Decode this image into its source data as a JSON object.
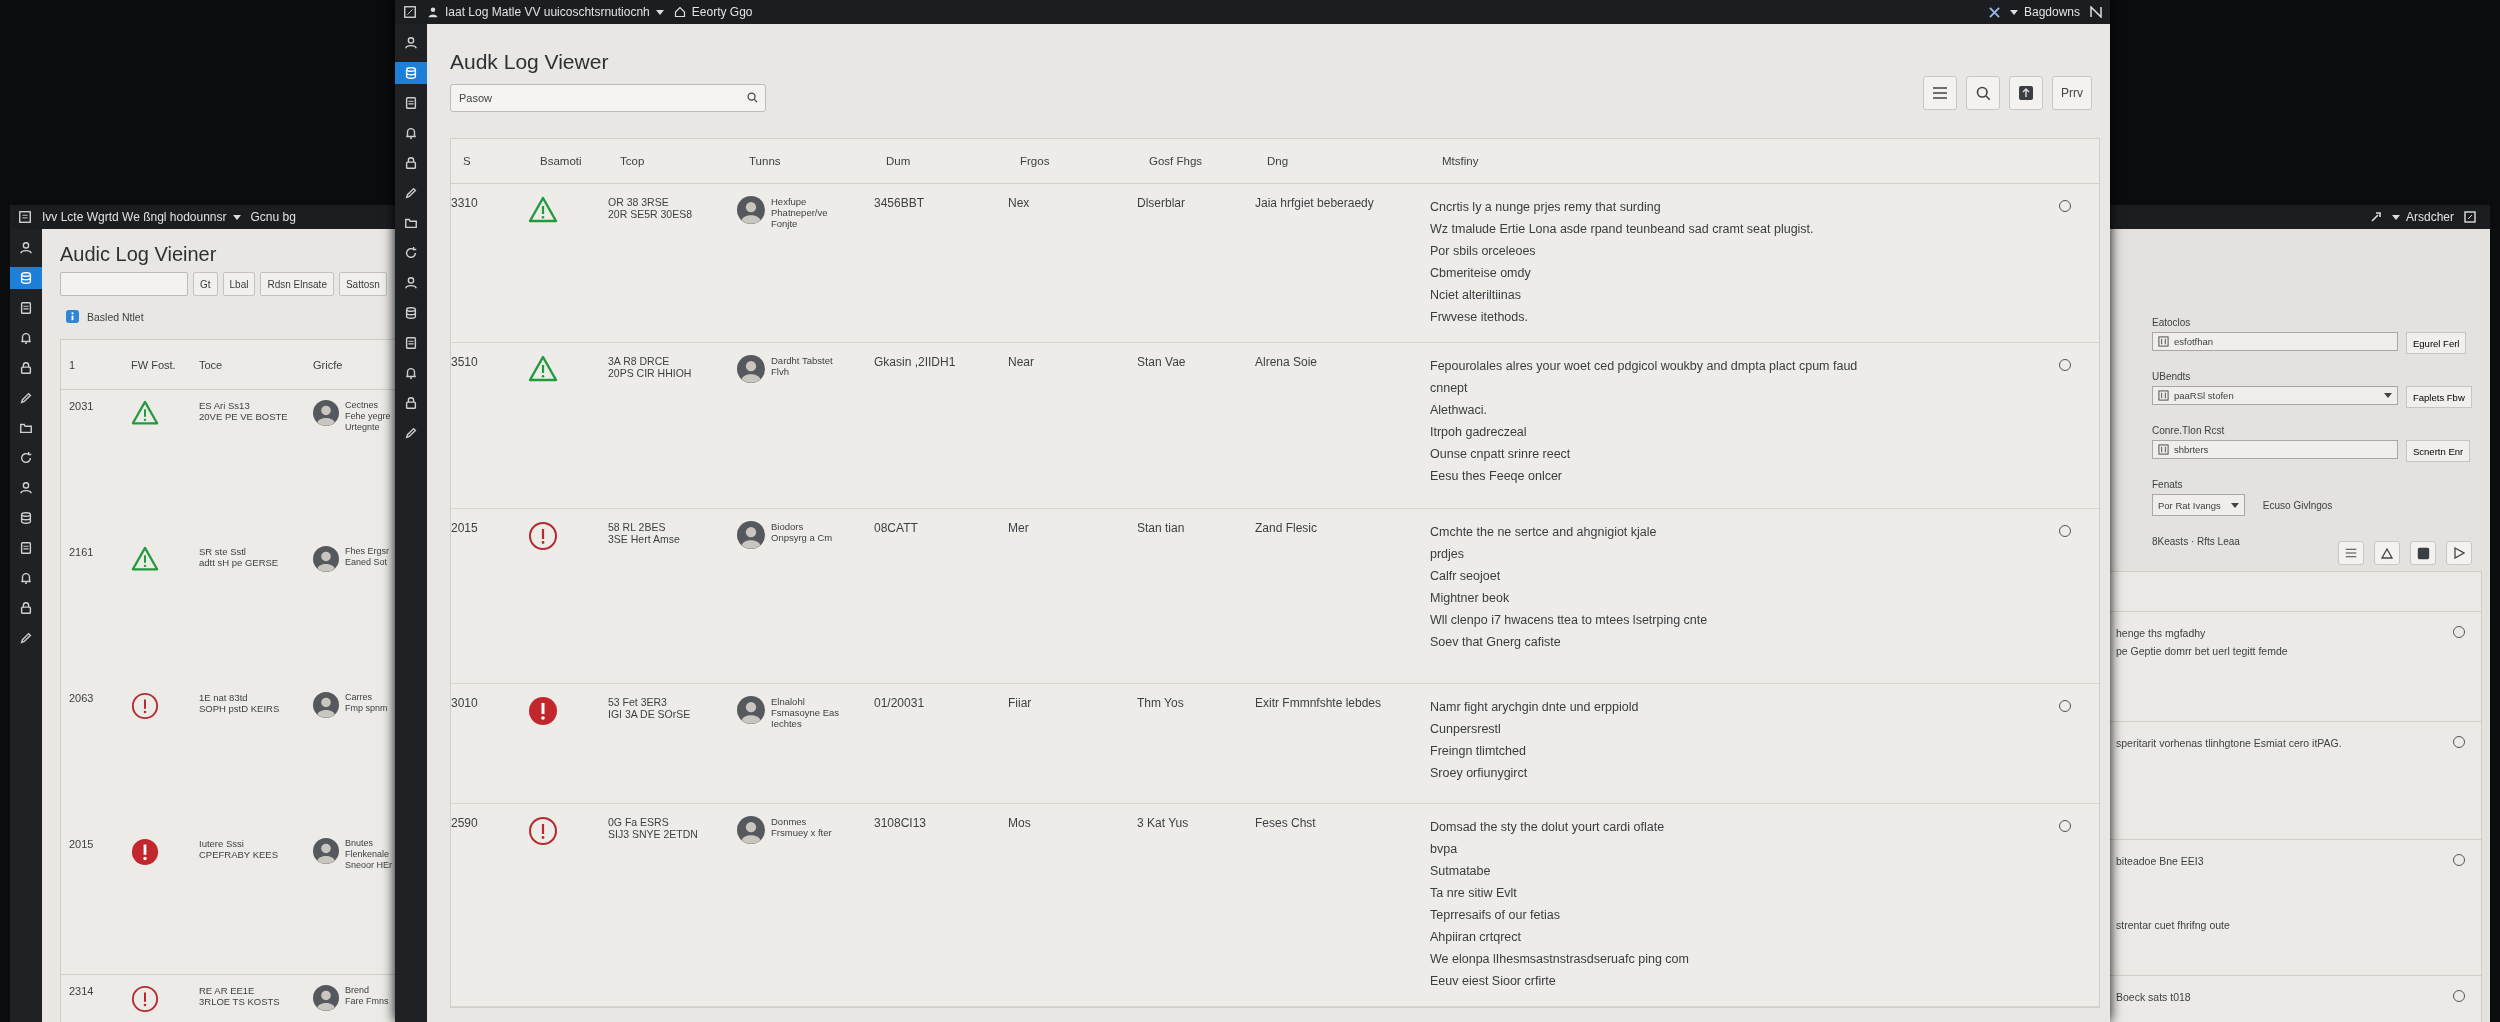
{
  "left_window": {
    "titlebar": {
      "title": "Ivv Lcte Wgrtd We ßngl hodounnsr",
      "link": "Gcnu bg"
    },
    "rail": [
      {
        "selected": false
      },
      {
        "selected": true
      },
      {
        "selected": false
      },
      {
        "selected": false
      },
      {
        "selected": false
      },
      {
        "selected": false
      },
      {
        "selected": false
      },
      {
        "selected": false
      },
      {
        "selected": false
      },
      {
        "selected": false
      },
      {
        "selected": false
      },
      {
        "selected": false
      },
      {
        "selected": false
      },
      {
        "selected": false
      }
    ],
    "heading": "Audic Log Vieiner",
    "search_button": "Gt",
    "buttons": [
      "Lbal",
      "Rdsn Elnsate",
      "Sattosn"
    ],
    "notice": "Basled Ntlet",
    "table": {
      "columns": [
        "1",
        "FW Fost.",
        "Toce",
        "Gricfe"
      ],
      "rows": [
        {
          "id": "2031",
          "kind": "warning",
          "time": [
            "ES Ari Ss13",
            "20VE PE VE BOSTE"
          ],
          "user": [
            "Cectnes",
            "Fehe yegre",
            "Urtegnte"
          ]
        },
        {
          "id": "2161",
          "kind": "warning",
          "time": [
            "SR ste Sstl",
            "adtt sH pe GERSE"
          ],
          "user": [
            "Fhes Ergsr",
            "Eaned Sot"
          ]
        },
        {
          "id": "2063",
          "kind": "error",
          "time": [
            "1E nat 83td",
            "SOPH pstD KEIRS"
          ],
          "user": [
            "Carres",
            "Fmp spnm"
          ]
        },
        {
          "id": "2015",
          "kind": "critical",
          "time": [
            "Iutere Sssi",
            "CPEFRABY KEES"
          ],
          "user": [
            "Bnutes",
            "Flenkenale",
            "Sneoor HEr"
          ]
        },
        {
          "id": "2314",
          "kind": "error",
          "time": [
            "RE AR EE1E",
            "3RLOE TS KOSTS"
          ],
          "user": [
            "Brend",
            "Fare Fmns"
          ]
        }
      ]
    }
  },
  "main_window": {
    "titlebar": {
      "app_menu": "Iaat Log Matle VV uuicoschtsrnutiocnh",
      "location": "Eeorty Ggo",
      "user": "Bagdowns"
    },
    "rail": [
      {
        "selected": false
      },
      {
        "selected": true
      },
      {
        "selected": false
      },
      {
        "selected": false
      },
      {
        "selected": false
      },
      {
        "selected": false
      },
      {
        "selected": false
      },
      {
        "selected": false
      },
      {
        "selected": false
      },
      {
        "selected": false
      },
      {
        "selected": false
      },
      {
        "selected": false
      },
      {
        "selected": false
      },
      {
        "selected": false
      }
    ],
    "heading": "Audk Log Viewer",
    "search": {
      "value": "Pasow"
    },
    "toolbar_button": "Prrv",
    "table": {
      "columns": [
        "S",
        "Bsamoti",
        "Tcop",
        "Tunns",
        "Dum",
        "Frgos",
        "Gosf Fhgs",
        "Dng",
        "Mtsfiny"
      ],
      "rows": [
        {
          "id": "3310",
          "kind": "warning",
          "time": [
            "OR 38 3RSE",
            "20R SE5R 30ES8"
          ],
          "user": [
            "Hexfupe",
            "Phatneper/ve",
            "Fonjte"
          ],
          "col_5": "3456BBT",
          "col_6": "Nex",
          "col_7": "Dlserblar",
          "col_8": "Jaia hrfgiet beberaedy",
          "message": [
            "Cncrtis ly a nunge prjes remy that surding",
            "Wz tmalude Ertie Lona asde rpand teunbeand sad cramt seat plugist.",
            "Por sbils orceleoes",
            "Cbmeriteise omdy",
            "Nciet alteriltiinas",
            "Frwvese itethods."
          ],
          "selected": false
        },
        {
          "id": "3510",
          "kind": "warning",
          "time": [
            "3A R8 DRCE",
            "20PS CIR HHIOH"
          ],
          "user": [
            "Dardht Tabstet",
            "Flvh"
          ],
          "col_5": "Gkasin ,2IIDH1",
          "col_6": "Near",
          "col_7": "Stan Vae",
          "col_8": "Alrena Soie",
          "message": [
            "Fepourolales alres your woet ced pdgicol woukby and dmpta plact cpum faud",
            "cnnept",
            "Alethwaci.",
            "Itrpoh gadreczeal",
            "Ounse cnpatt srinre reect",
            "Eesu thes Feeqe onlcer"
          ],
          "selected": false
        },
        {
          "id": "2015",
          "kind": "error",
          "time": [
            "58 RL 2BES",
            "3SE Hert Amse"
          ],
          "user": [
            "Biodors",
            "Onpsyrg a Cm"
          ],
          "col_5": "08CATT",
          "col_6": "Mer",
          "col_7": "Stan tian",
          "col_8": "Zand Flesic",
          "message": [
            "Cmchte the ne sertce and ahgnigiot kjale",
            "prdjes",
            "Calfr seojoet",
            "Mightner beok",
            "Wll clenpo i7 hwacens ttea to mtees lsetrping cnte",
            "Soev that Gnerg cafiste"
          ],
          "selected": false
        },
        {
          "id": "3010",
          "kind": "critical",
          "time": [
            "53 Fet 3ER3",
            "IGI 3A DE SOrSE"
          ],
          "user": [
            "Elnalohl",
            "Fsmasoyne Eas",
            "Iechtes"
          ],
          "col_5": "01/20031",
          "col_6": "Fiiar",
          "col_7": "Thm Yos",
          "col_8": "Exitr Fmmnfshte lebdes",
          "message": [
            "Namr fight arychgin dnte und erppiold",
            "Cunpersrestl",
            "Freingn tlimtched",
            "Sroey orfiunygirct"
          ],
          "selected": false
        },
        {
          "id": "2590",
          "kind": "error",
          "time": [
            "0G Fa ESRS",
            "SIJ3 SNYE 2ETDN"
          ],
          "user": [
            "Donmes",
            "Frsmuey x fter"
          ],
          "col_5": "3108CI13",
          "col_6": "Mos",
          "col_7": "3 Kat Yus",
          "col_8": "Feses Chst",
          "message": [
            "Domsad the sty the dolut yourt cardi oflate",
            "bvpa",
            "Sutmatabe",
            "Ta nre sitiw Evlt",
            "Teprresaifs of our fetias",
            "Ahpiiran crtqrect",
            "We elonpa lIhesmsastnstrasdseruafc ping com",
            "Eeuv eiest Sioor crfirte"
          ],
          "selected": false
        }
      ]
    }
  },
  "right_window": {
    "titlebar": {
      "user": "Arsdcher"
    },
    "fields": [
      {
        "kind": "input",
        "label": "Eatoclos",
        "value": "esfotfhan",
        "button": "Egurel Ferl"
      },
      {
        "kind": "select",
        "label": "UBendts",
        "value": "paaRSl stofen",
        "button": "Faplets Fbw"
      },
      {
        "kind": "input",
        "label": "Conre.Tlon Rcst",
        "value": "shbrters",
        "button": "Scnertn Enr"
      }
    ],
    "filter": {
      "label": "Fenats",
      "value": "Por Rat Ivangs",
      "link": "Ecuso Givlngos"
    },
    "summary": "8Keasts · Rfts Leaa",
    "rows": [
      {
        "lines": [
          "henge ths mgfadhy",
          "pe Geptie domrr bet uerl tegitt femde"
        ],
        "selected": false
      },
      {
        "lines": [
          "speritarit vorhenas tlinhgtone Esmiat cero itPAG."
        ],
        "selected": false
      },
      {
        "lines": [
          "biteadoe Bne EEI3",
          "strentar cuet fhrifng oute"
        ],
        "selected": false
      },
      {
        "lines": [
          "Boeck sats t018"
        ],
        "selected": false
      }
    ]
  }
}
